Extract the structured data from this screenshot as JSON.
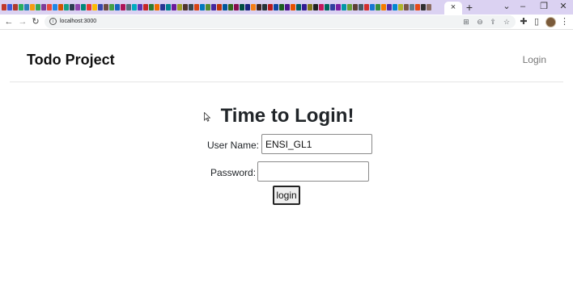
{
  "browser": {
    "tab_favicon_colors": [
      "#c0392b",
      "#3b5bdb",
      "#b03a2e",
      "#27ae60",
      "#2980b9",
      "#f39c12",
      "#34a853",
      "#7d3c98",
      "#e74c3c",
      "#1e88e5",
      "#d35400",
      "#16a085",
      "#2c3e50",
      "#8e44ad",
      "#00897b",
      "#e53935",
      "#fbbc05",
      "#3949ab",
      "#6d4c41",
      "#43a047",
      "#1565c0",
      "#ad1457",
      "#546e7a",
      "#00acc1",
      "#5e35b1",
      "#c62828",
      "#2e7d32",
      "#ef6c00",
      "#283593",
      "#00838f",
      "#6a1b9a",
      "#9e9d24",
      "#4e342e",
      "#37474f",
      "#d84315",
      "#0277bd",
      "#558b2f",
      "#4527a0",
      "#bf360c",
      "#01579b",
      "#33691e",
      "#880e4f",
      "#004d40",
      "#1a237e",
      "#f57f17",
      "#3e2723",
      "#263238",
      "#b71c1c",
      "#0d47a1",
      "#1b5e20",
      "#4a148c",
      "#e65100",
      "#006064",
      "#311b92",
      "#827717",
      "#212121",
      "#c2185b",
      "#00695c",
      "#303f9f",
      "#7b1fa2",
      "#0097a7",
      "#689f38",
      "#5d4037",
      "#455a64",
      "#d32f2f",
      "#1976d2",
      "#388e3c",
      "#f57c00",
      "#512da8",
      "#0288d1",
      "#afb42b",
      "#795548",
      "#607d8b",
      "#e64a19",
      "#303030",
      "#8d6e63"
    ],
    "tab_close": "×",
    "new_tab": "+",
    "window_controls": {
      "dropdown": "⌄",
      "minimize": "–",
      "restore": "❐",
      "close": "✕"
    },
    "nav": {
      "back": "←",
      "forward": "→",
      "reload": "↻"
    },
    "address": {
      "url": "localhost:3000",
      "info_icon": "i"
    },
    "omnibox_icons": {
      "install": "⊞",
      "zoom": "⊖",
      "share": "⇪",
      "bookmark": "☆"
    },
    "extensions": "✚",
    "sidebar_toggle": "▯",
    "menu": "⋮"
  },
  "navbar": {
    "brand": "Todo Project",
    "login_link": "Login"
  },
  "main": {
    "title": "Time to Login!",
    "username_label": "User Name:",
    "username_value": "ENSI_GL1",
    "password_label": "Password:",
    "password_value": "",
    "login_button": "login"
  }
}
